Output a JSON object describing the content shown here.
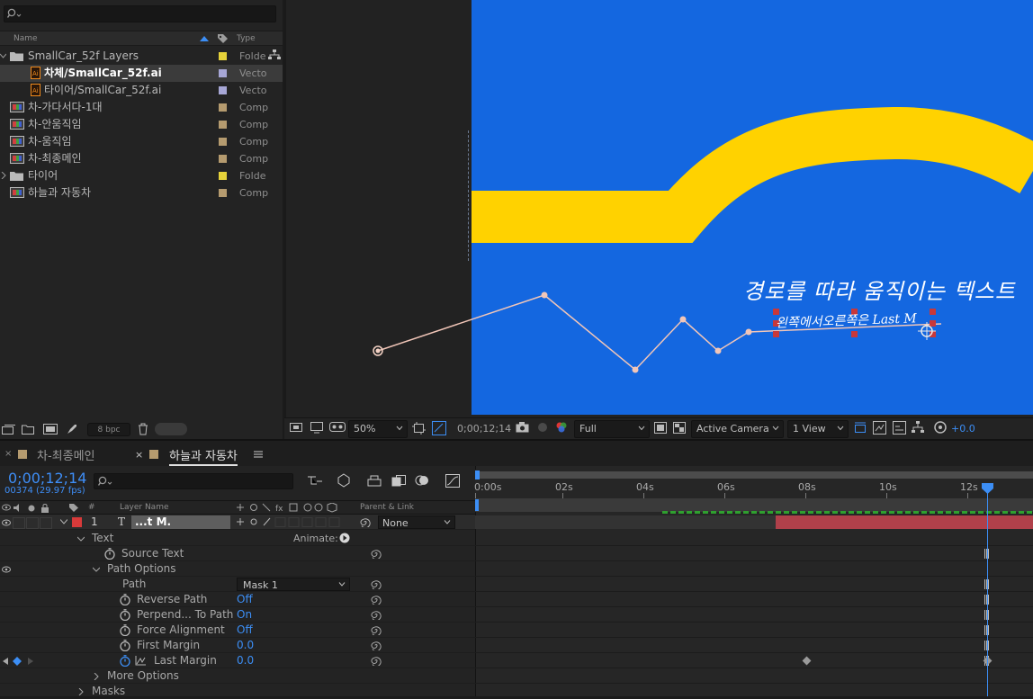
{
  "project": {
    "search_placeholder": "",
    "columns": {
      "name": "Name",
      "type": "Type"
    },
    "items": [
      {
        "name": "SmallCar_52f Layers",
        "type": "Folde",
        "label_color": "#e6d23a",
        "indent": 0,
        "kind": "folder",
        "expanded": true
      },
      {
        "name": "차체/SmallCar_52f.ai",
        "type": "Vecto",
        "label_color": "#a7a7d6",
        "indent": 1,
        "kind": "ai",
        "selected": true
      },
      {
        "name": "타이어/SmallCar_52f.ai",
        "type": "Vecto",
        "label_color": "#a7a7d6",
        "indent": 1,
        "kind": "ai"
      },
      {
        "name": "차-가다서다-1대",
        "type": "Comp",
        "label_color": "#b59b6f",
        "indent": 0,
        "kind": "comp"
      },
      {
        "name": "차-안움직임",
        "type": "Comp",
        "label_color": "#b59b6f",
        "indent": 0,
        "kind": "comp"
      },
      {
        "name": "차-움직임",
        "type": "Comp",
        "label_color": "#b59b6f",
        "indent": 0,
        "kind": "comp"
      },
      {
        "name": "차-최종메인",
        "type": "Comp",
        "label_color": "#b59b6f",
        "indent": 0,
        "kind": "comp"
      },
      {
        "name": "타이어",
        "type": "Folde",
        "label_color": "#e6d23a",
        "indent": 0,
        "kind": "folder",
        "expanded": false
      },
      {
        "name": "하늘과 자동차",
        "type": "Comp",
        "label_color": "#b59b6f",
        "indent": 0,
        "kind": "comp"
      }
    ],
    "bpc": "8 bpc"
  },
  "viewer": {
    "title_text": "경로를 따라 움직이는 텍스트",
    "path_text": "왼쪽에서오른쪽은 Last M",
    "zoom": "50%",
    "timecode": "0;00;12;14",
    "resolution": "Full",
    "camera": "Active Camera",
    "view": "1 View",
    "exposure": "+0.0",
    "canvas_color": "#1467e0",
    "road_color": "#ffd200"
  },
  "timeline": {
    "tabs": [
      {
        "label": "차-최종메인",
        "active": false
      },
      {
        "label": "하늘과 자동차",
        "active": true
      }
    ],
    "timecode": "0;00;12;14",
    "frames_fps": "00374 (29.97 fps)",
    "col_layer_name": "Layer Name",
    "col_parent": "Parent & Link",
    "ruler_labels": [
      "0:00s",
      "02s",
      "04s",
      "06s",
      "08s",
      "10s",
      "12s"
    ],
    "layer": {
      "num": "1",
      "type_icon": "T",
      "name": "...t M.",
      "parent": "None",
      "color": "#d83a3a"
    },
    "props": [
      {
        "label": "Text",
        "level": 0,
        "twirl": "open",
        "extra": "Animate:"
      },
      {
        "label": "Source Text",
        "level": 1,
        "stopwatch": true
      },
      {
        "label": "Path Options",
        "level": 1,
        "twirl": "open"
      },
      {
        "label": "Path",
        "level": 2,
        "dropdown": "Mask 1"
      },
      {
        "label": "Reverse Path",
        "level": 2,
        "stopwatch": true,
        "value": "Off"
      },
      {
        "label": "Perpend... To Path",
        "level": 2,
        "stopwatch": true,
        "value": "On"
      },
      {
        "label": "Force Alignment",
        "level": 2,
        "stopwatch": true,
        "value": "Off"
      },
      {
        "label": "First Margin",
        "level": 2,
        "stopwatch": true,
        "value": "0.0"
      },
      {
        "label": "Last Margin",
        "level": 2,
        "stopwatch": true,
        "value": "0.0",
        "keyframed": true
      },
      {
        "label": "More Options",
        "level": 1,
        "twirl": "closed"
      },
      {
        "label": "Masks",
        "level": 0,
        "twirl": "closed"
      }
    ],
    "bar_color": "#b0404a",
    "cti_color": "#3c8ef5"
  }
}
